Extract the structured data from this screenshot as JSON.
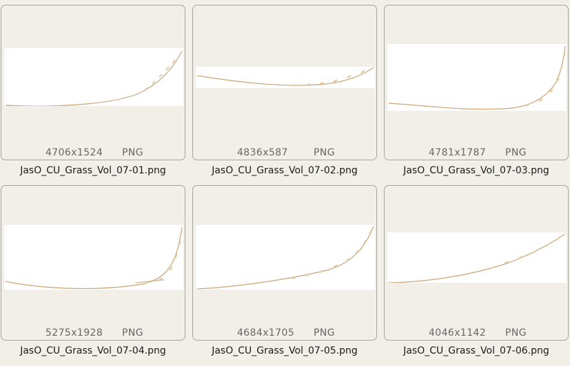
{
  "files": [
    {
      "filename": "JasO_CU_Grass_Vol_07-01.png",
      "dimensions": "4706x1524",
      "format": "PNG"
    },
    {
      "filename": "JasO_CU_Grass_Vol_07-02.png",
      "dimensions": "4836x587",
      "format": "PNG"
    },
    {
      "filename": "JasO_CU_Grass_Vol_07-03.png",
      "dimensions": "4781x1787",
      "format": "PNG"
    },
    {
      "filename": "JasO_CU_Grass_Vol_07-04.png",
      "dimensions": "5275x1928",
      "format": "PNG"
    },
    {
      "filename": "JasO_CU_Grass_Vol_07-05.png",
      "dimensions": "4684x1705",
      "format": "PNG"
    },
    {
      "filename": "JasO_CU_Grass_Vol_07-06.png",
      "dimensions": "4046x1142",
      "format": "PNG"
    }
  ],
  "colors": {
    "background": "#f1efe8",
    "card_border": "#a6a49c",
    "grass_stem": "#c9a476",
    "grass_seed": "#e2c9a3"
  }
}
